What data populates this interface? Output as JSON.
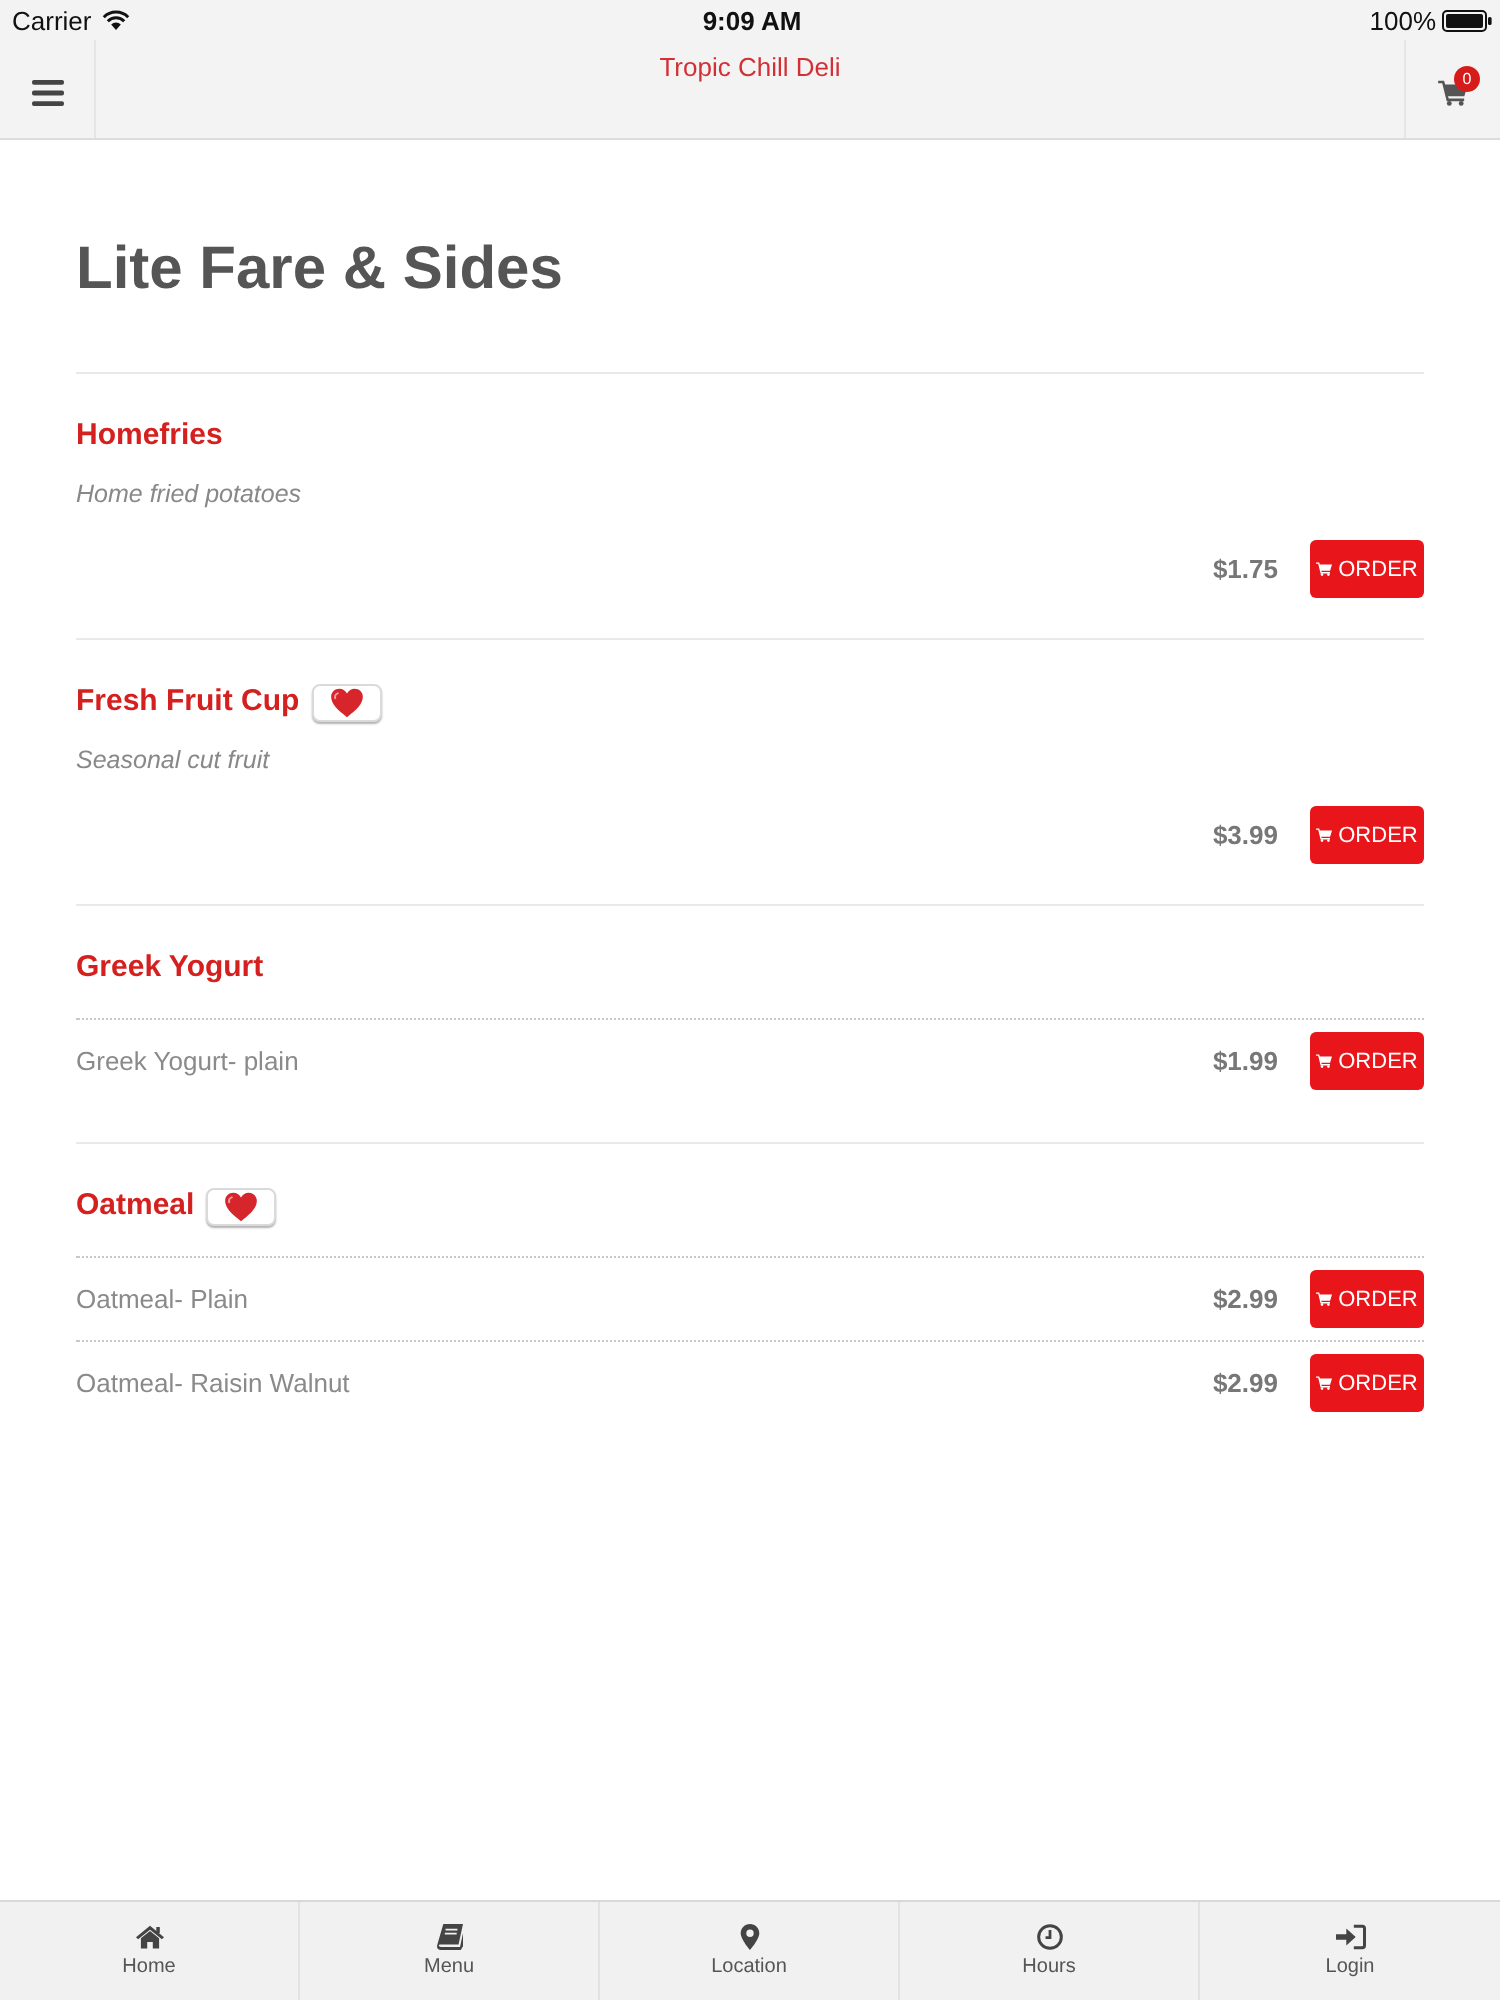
{
  "status_bar": {
    "carrier": "Carrier",
    "time": "9:09 AM",
    "battery": "100%"
  },
  "nav_bar": {
    "title": "Tropic Chill Deli",
    "cart_count": "0"
  },
  "page_title": "Lite Fare & Sides",
  "sections": [
    {
      "name": "Homefries",
      "heart": false,
      "description": "Home fried potatoes",
      "items": [
        {
          "kind": "plain",
          "price": "$1.75",
          "button": "ORDER"
        }
      ]
    },
    {
      "name": "Fresh Fruit Cup",
      "heart": true,
      "description": "Seasonal cut fruit",
      "items": [
        {
          "kind": "plain",
          "price": "$3.99",
          "button": "ORDER"
        }
      ]
    },
    {
      "name": "Greek Yogurt",
      "heart": false,
      "items": [
        {
          "kind": "option",
          "label": "Greek Yogurt- plain",
          "price": "$1.99",
          "button": "ORDER"
        }
      ]
    },
    {
      "name": "Oatmeal",
      "heart": true,
      "items": [
        {
          "kind": "option",
          "label": "Oatmeal- Plain",
          "price": "$2.99",
          "button": "ORDER"
        },
        {
          "kind": "option",
          "label": "Oatmeal- Raisin Walnut",
          "price": "$2.99",
          "button": "ORDER"
        }
      ]
    }
  ],
  "tab_bar": [
    {
      "label": "Home"
    },
    {
      "label": "Menu"
    },
    {
      "label": "Location"
    },
    {
      "label": "Hours"
    },
    {
      "label": "Login"
    }
  ]
}
